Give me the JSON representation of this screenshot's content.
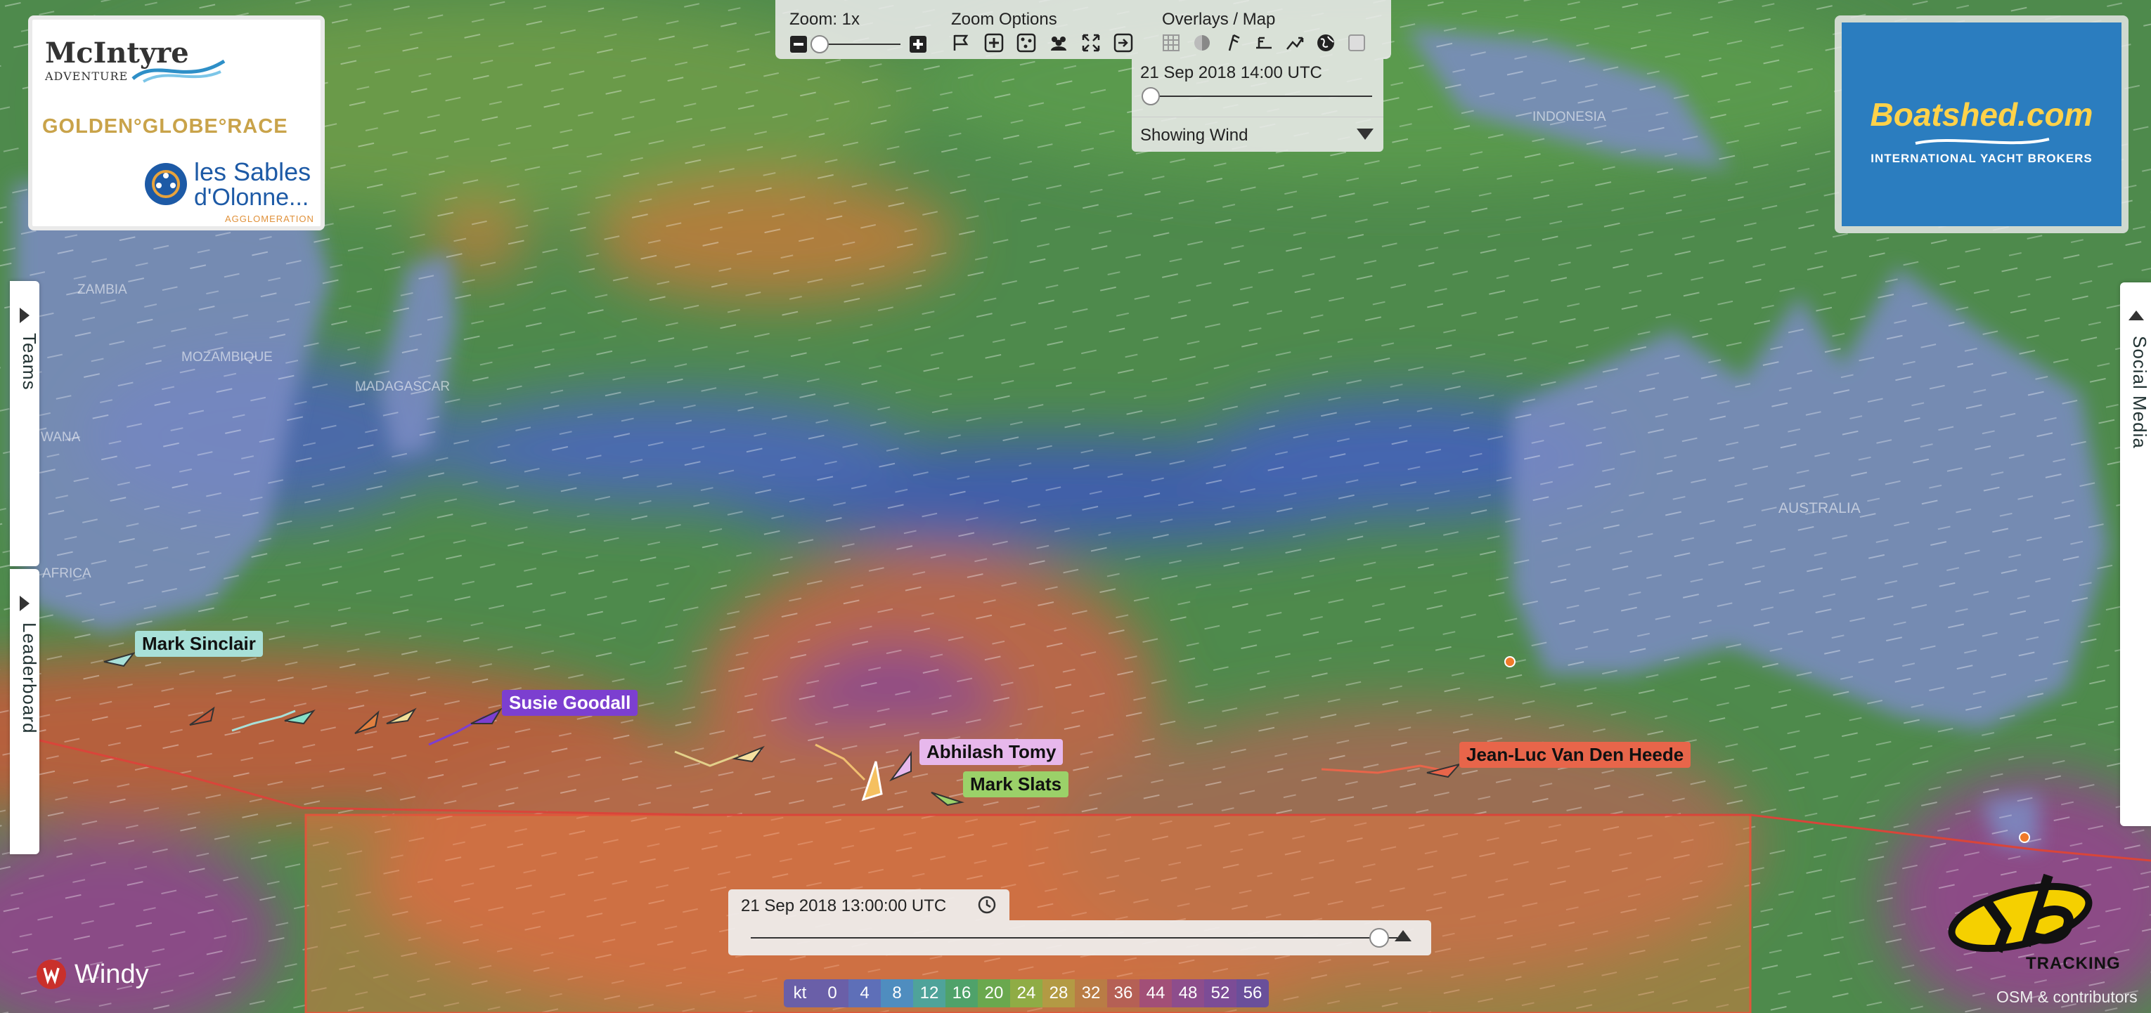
{
  "zoom": {
    "label": "Zoom: 1x",
    "level": 0.0
  },
  "zoom_options": {
    "label": "Zoom Options"
  },
  "overlays": {
    "label": "Overlays / Map"
  },
  "time_panel": {
    "datetime": "21 Sep 2018 14:00 UTC",
    "dropdown": "Showing Wind"
  },
  "playback": {
    "datetime": "21 Sep 2018 13:00:00 UTC",
    "position": 0.97
  },
  "side_tabs": {
    "teams": "Teams",
    "leaderboard": "Leaderboard",
    "social": "Social Media"
  },
  "sponsors": {
    "mcintyre_1": "McIntyre",
    "mcintyre_2": "ADVENTURE",
    "ggr": "GOLDEN°GLOBE°RACE",
    "sables_1": "les Sables",
    "sables_2": "d'Olonne...",
    "sables_3": "AGGLOMERATION",
    "boatshed": "Boatshed.com",
    "boatshed_sub": "INTERNATIONAL YACHT BROKERS",
    "yb_text": "TRACKING"
  },
  "windy": {
    "label": "Windy"
  },
  "attribution": "OSM & contributors",
  "map_labels": {
    "zambia": "ZAMBIA",
    "mozambique": "MOZAMBIQUE",
    "madagascar": "MADAGASCAR",
    "australia": "AUSTRALIA",
    "indonesia": "INDONESIA",
    "africa": "AFRICA",
    "botswana": "WANA"
  },
  "boats": [
    {
      "name": "Mark Sinclair",
      "color": "#a8e0d8",
      "text_color": "#111"
    },
    {
      "name": "Susie Goodall",
      "color": "#7c3fd0",
      "text_color": "#fff"
    },
    {
      "name": "Abhilash Tomy",
      "color": "#e7b8ec",
      "text_color": "#111"
    },
    {
      "name": "Mark Slats",
      "color": "#9bd169",
      "text_color": "#111"
    },
    {
      "name": "Jean-Luc Van Den Heede",
      "color": "#e8654a",
      "text_color": "#111"
    }
  ],
  "wind_scale": {
    "unit": "kt",
    "values": [
      "0",
      "4",
      "8",
      "12",
      "16",
      "20",
      "24",
      "28",
      "32",
      "36",
      "44",
      "48",
      "52",
      "56"
    ],
    "colors": [
      "#6a5fa8",
      "#5e6fb8",
      "#4f8dbf",
      "#4fa39a",
      "#4fa26a",
      "#6aa84e",
      "#8fac45",
      "#b39a44",
      "#b97c45",
      "#b56055",
      "#a24f77",
      "#8d4d8c",
      "#7c4c96",
      "#6a4f9a"
    ]
  },
  "colors": {
    "accent": "#e8654a",
    "panel": "#ebebeb"
  }
}
